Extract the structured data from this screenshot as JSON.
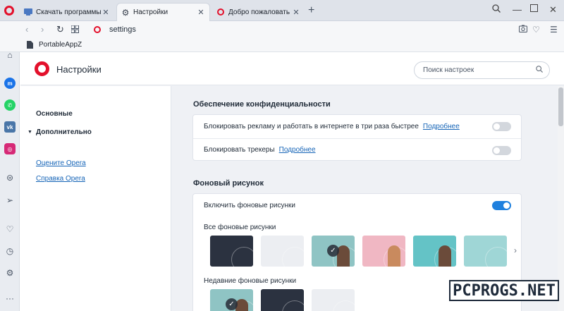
{
  "browser": {
    "tabs": [
      {
        "title": "Скачать программы для а",
        "icon": "pcprogs-favicon",
        "active": false
      },
      {
        "title": "Настройки",
        "icon": "gear-icon",
        "active": true
      },
      {
        "title": "Добро пожаловать в Oper",
        "icon": "opera-favicon",
        "active": false
      }
    ],
    "new_tab": "+",
    "address": {
      "url": "settings"
    },
    "bookmarks": [
      {
        "label": "PortableAppZ"
      }
    ],
    "accent": "#e3102b"
  },
  "sidebar_icons": [
    {
      "name": "speed-dial-icon"
    },
    {
      "name": "messenger-icon",
      "color": "#1a73e8"
    },
    {
      "name": "whatsapp-icon",
      "color": "#25d366"
    },
    {
      "name": "vk-icon",
      "color": "#4a76a8"
    },
    {
      "name": "instagram-icon",
      "color": "#d62976"
    },
    {
      "name": "player-icon"
    },
    {
      "name": "send-icon"
    },
    {
      "name": "heart-icon"
    },
    {
      "name": "history-icon"
    },
    {
      "name": "settings-icon"
    },
    {
      "name": "more-icon"
    }
  ],
  "settings": {
    "title": "Настройки",
    "search_placeholder": "Поиск настроек",
    "nav": {
      "basic": "Основные",
      "advanced": "Дополнительно",
      "rate": "Оцените Opera",
      "help": "Справка Opera"
    },
    "privacy": {
      "heading": "Обеспечение конфиденциальности",
      "block_ads": "Блокировать рекламу и работать в интернете в три раза быстрее",
      "block_ads_on": false,
      "block_trackers": "Блокировать трекеры",
      "block_trackers_on": false,
      "more_label": "Подробнее"
    },
    "wallpapers": {
      "heading": "Фоновый рисунок",
      "enable": "Включить фоновые рисунки",
      "enable_on": true,
      "all_label": "Все фоновые рисунки",
      "recent_label": "Недавние фоновые рисунки",
      "all": [
        {
          "name": "wallpaper-dark",
          "bg": "#2b3240"
        },
        {
          "name": "wallpaper-light",
          "bg": "#eceef2"
        },
        {
          "name": "wallpaper-teal-man",
          "bg": "#8fc4c4",
          "selected": true
        },
        {
          "name": "wallpaper-pink-woman",
          "bg": "#f0b7c3"
        },
        {
          "name": "wallpaper-teal-woman",
          "bg": "#64c3c6"
        },
        {
          "name": "wallpaper-aqua",
          "bg": "#9fd6d6"
        }
      ],
      "recent": [
        {
          "name": "recent-teal-man",
          "bg": "#8fc4c4",
          "selected": true
        },
        {
          "name": "recent-dark",
          "bg": "#2b3240"
        },
        {
          "name": "recent-light",
          "bg": "#eceef2"
        }
      ]
    }
  },
  "watermark": "PCPROGS.NET"
}
